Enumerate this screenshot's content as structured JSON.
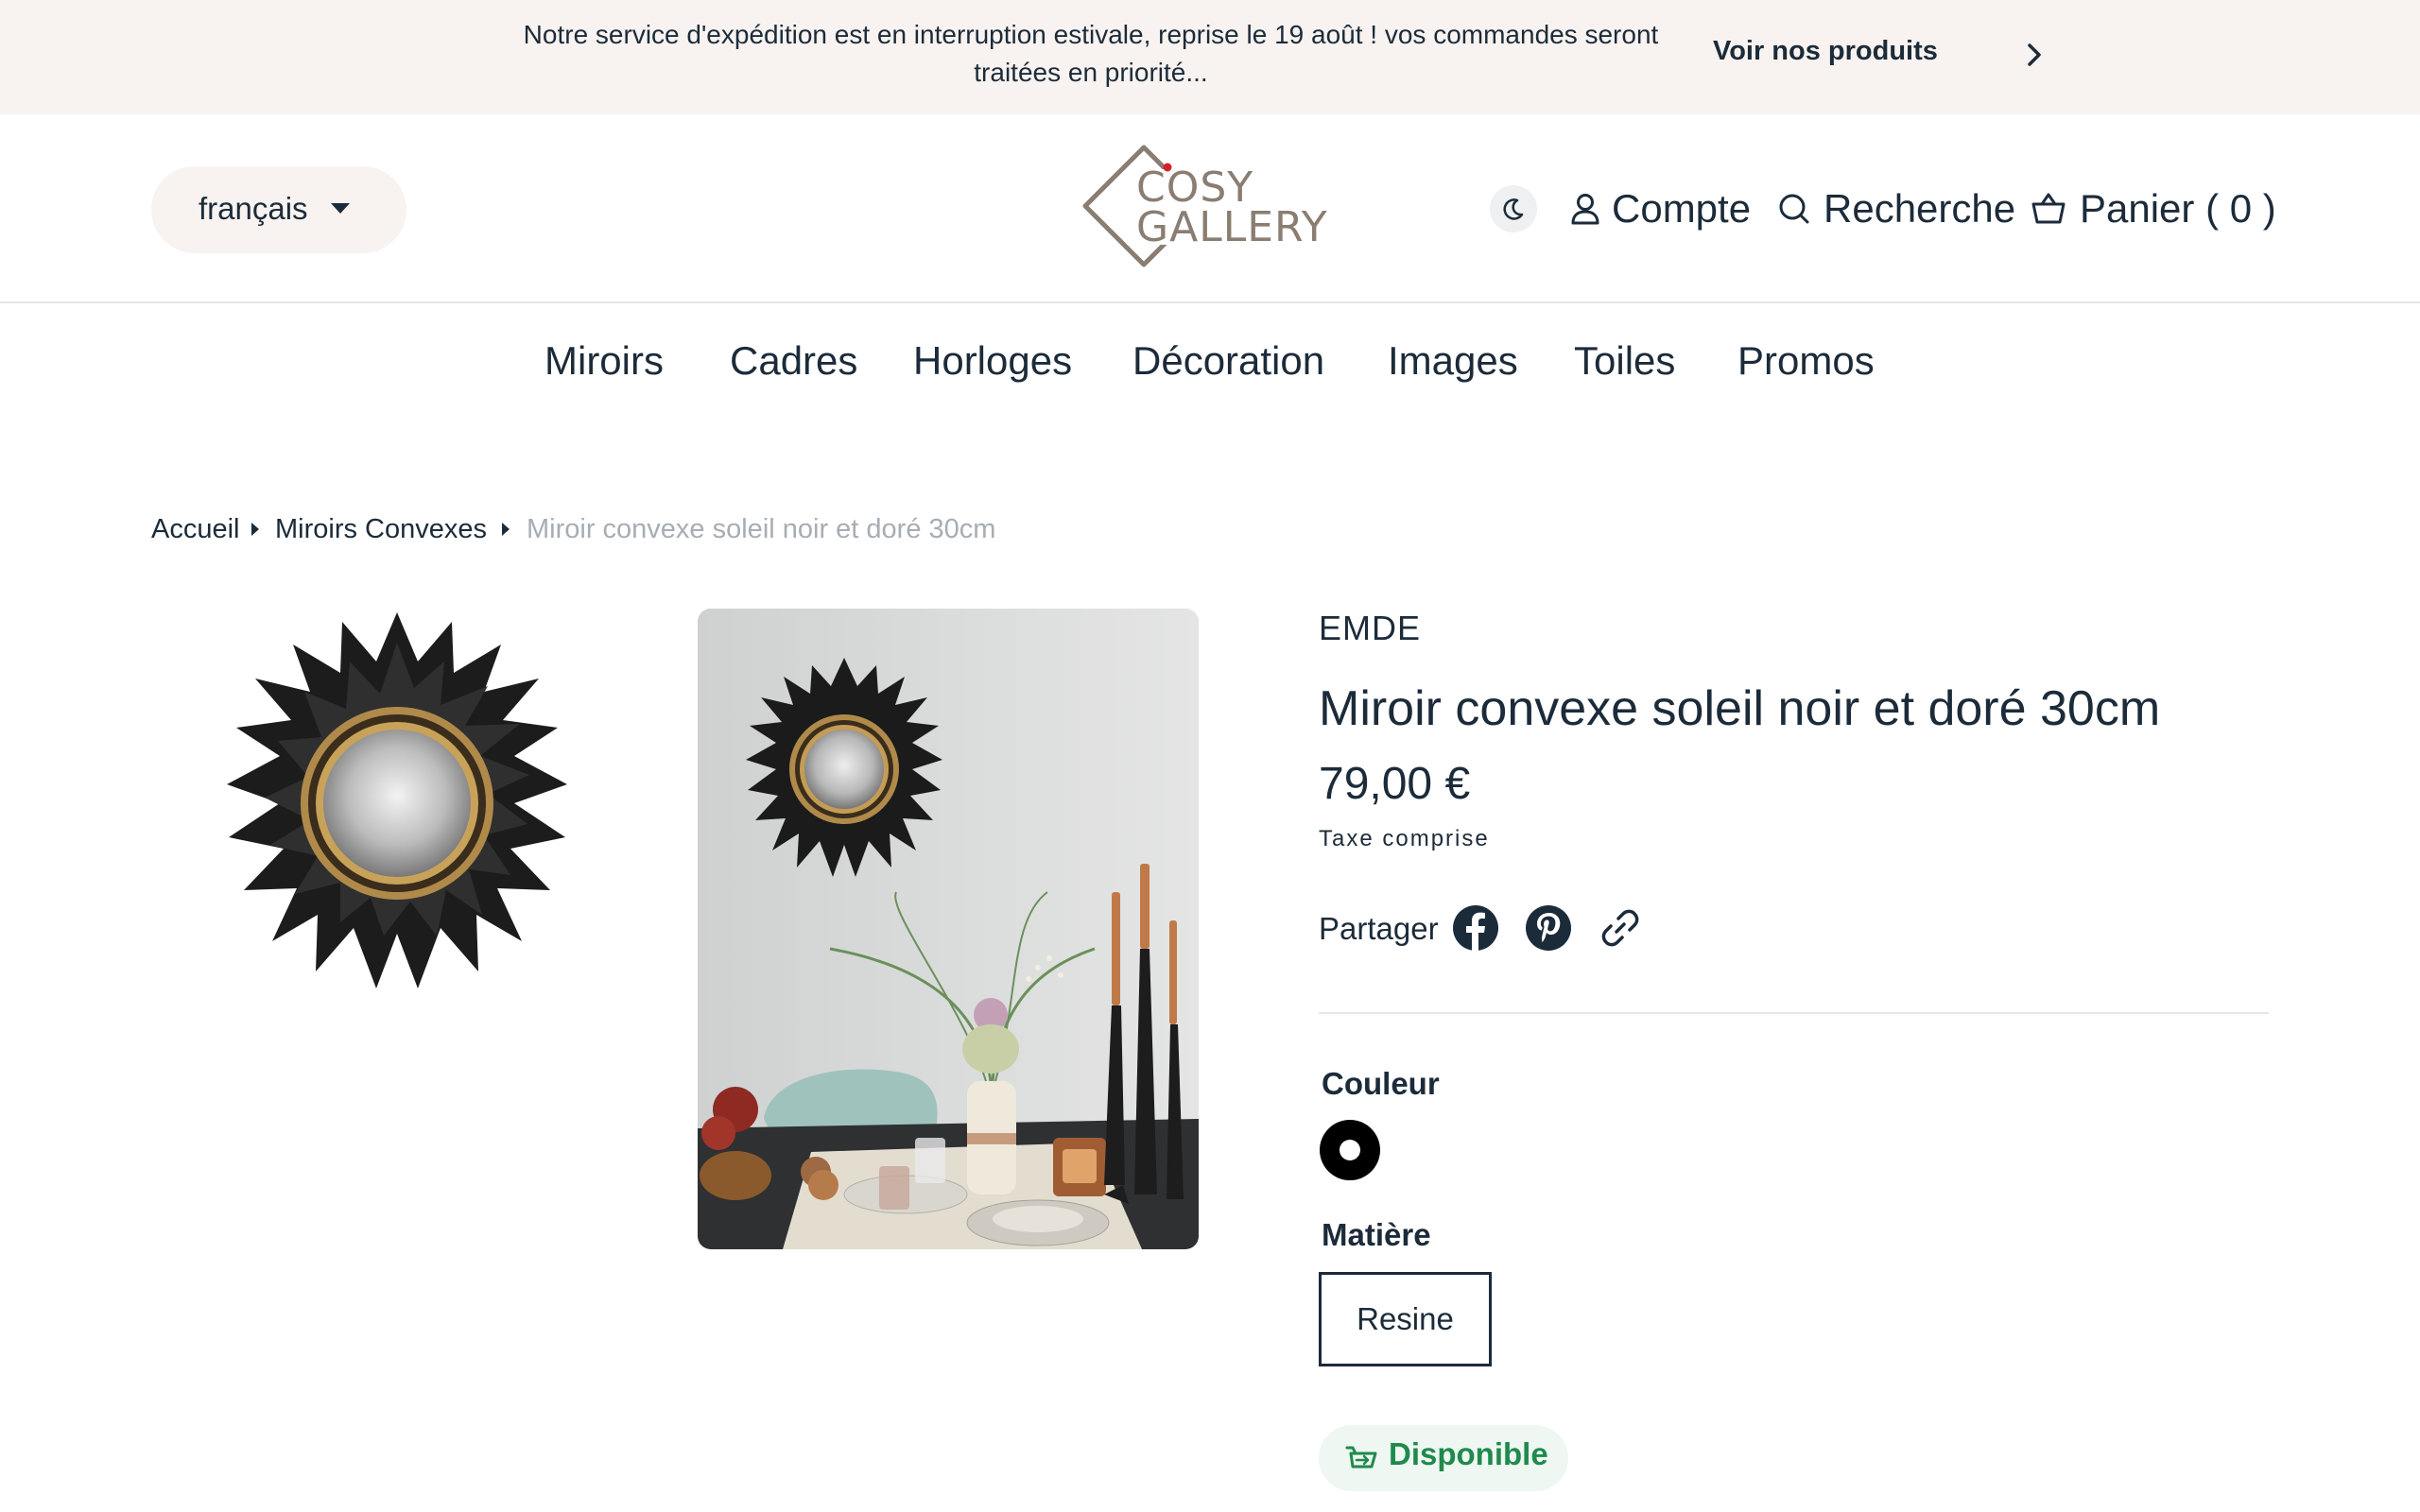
{
  "announcement": {
    "text": "Notre service d'expédition est en interruption estivale, reprise le 19 août ! vos commandes seront traitées en priorité...",
    "link_label": "Voir nos produits"
  },
  "header": {
    "language": "français",
    "logo_line1": "COSY",
    "logo_line2": "GALLERY",
    "account": "Compte",
    "search": "Recherche",
    "cart": "Panier ( 0 )"
  },
  "nav": {
    "items": [
      "Miroirs",
      "Cadres",
      "Horloges",
      "Décoration",
      "Images",
      "Toiles",
      "Promos"
    ]
  },
  "breadcrumb": {
    "items": [
      "Accueil",
      "Miroirs Convexes",
      "Miroir convexe soleil noir et doré 30cm"
    ]
  },
  "product": {
    "brand": "EMDE",
    "title": "Miroir convexe soleil noir et doré 30cm",
    "price": "79,00 €",
    "tax_note": "Taxe comprise",
    "share_label": "Partager",
    "color_label": "Couleur",
    "material_label": "Matière",
    "material_value": "Resine",
    "availability": "Disponible"
  },
  "colors": {
    "text": "#1c2b3a",
    "announcement_bg": "#f8f3f0",
    "available_green": "#1f8a4c",
    "muted": "#a7adb4"
  }
}
